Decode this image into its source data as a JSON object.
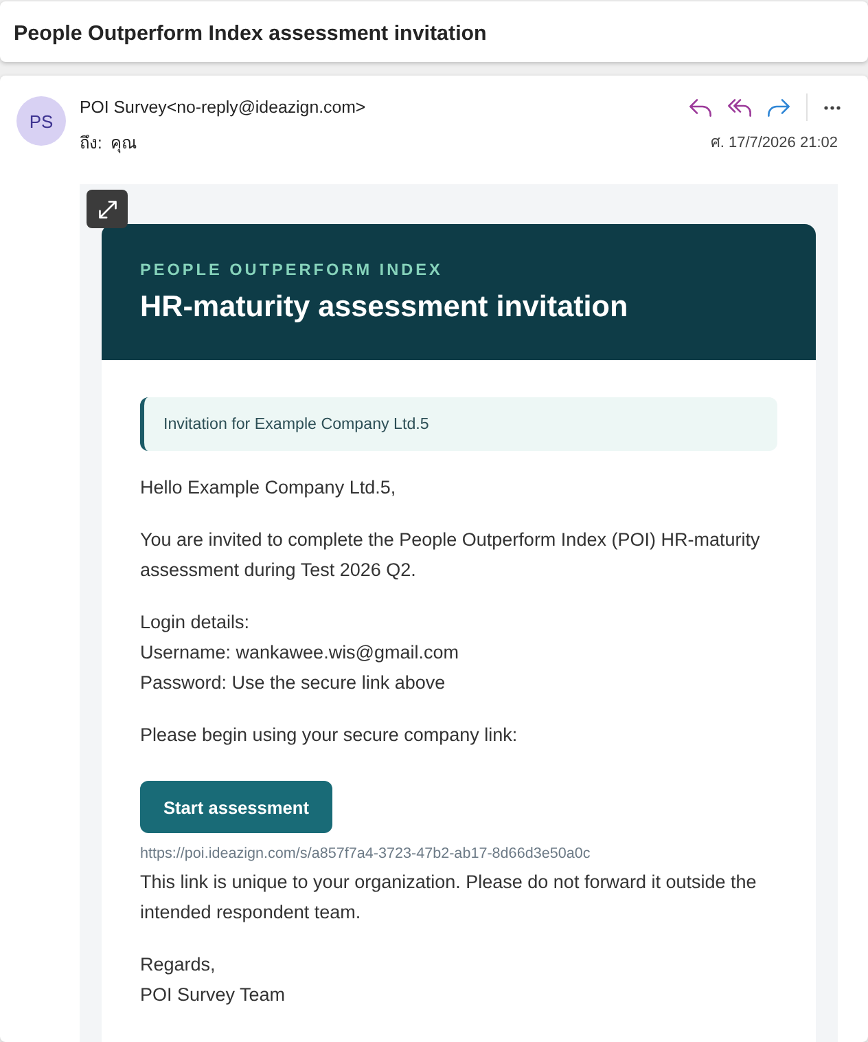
{
  "subject": "People Outperform Index assessment invitation",
  "message": {
    "avatar_initials": "PS",
    "sender": "POI Survey<no-reply@ideazign.com>",
    "to_label": "ถึง:",
    "recipient": "คุณ",
    "date": "ศ. 17/7/2026 21:02"
  },
  "email": {
    "eyebrow": "PEOPLE OUTPERFORM INDEX",
    "title": "HR-maturity assessment invitation",
    "callout": "Invitation for Example Company Ltd.5",
    "blocks": [
      {
        "kind": "text",
        "lines": [
          "Hello Example Company Ltd.5,"
        ]
      },
      {
        "kind": "text",
        "lines": [
          "You are invited to complete the People Outperform Index (POI) HR-maturity assessment during Test 2026 Q2."
        ]
      },
      {
        "kind": "text",
        "lines": [
          "Login details:",
          "Username: wankawee.wis@gmail.com",
          "Password: Use the secure link above"
        ]
      },
      {
        "kind": "text",
        "lines": [
          "Please begin using your secure company link:"
        ]
      },
      {
        "kind": "button",
        "label": "Start assessment"
      },
      {
        "kind": "link",
        "url": "https://poi.ideazign.com/s/a857f7a4-3723-47b2-ab17-8d66d3e50a0c"
      },
      {
        "kind": "text",
        "lines": [
          "This link is unique to your organization. Please do not forward it outside the intended respondent team."
        ]
      },
      {
        "kind": "text",
        "lines": [
          "Regards,",
          "POI Survey Team"
        ]
      }
    ]
  }
}
